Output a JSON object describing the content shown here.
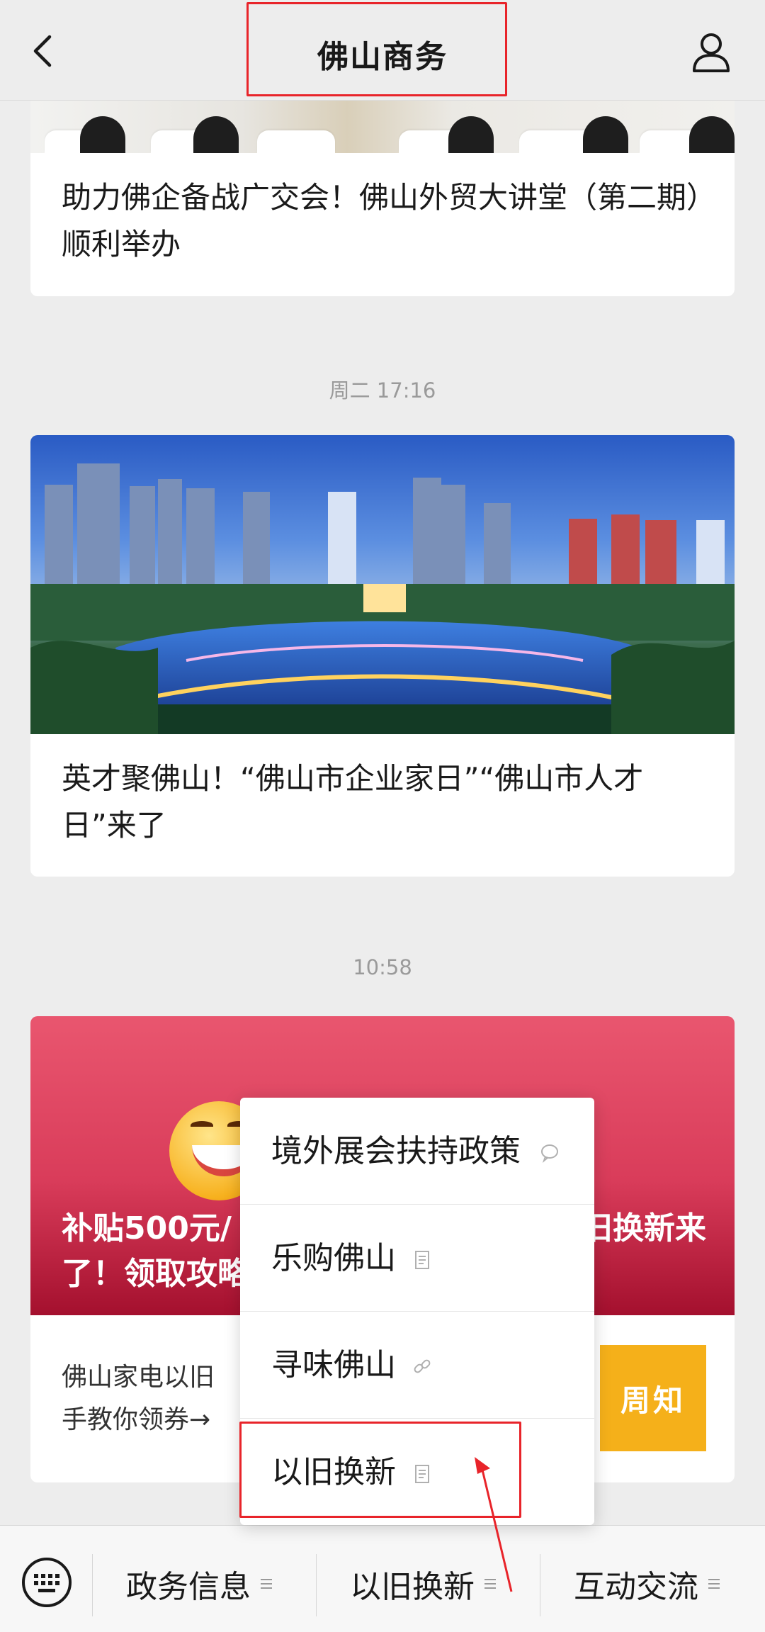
{
  "header": {
    "title": "佛山商务",
    "back_icon": "chevron-left-icon",
    "profile_icon": "person-icon"
  },
  "messages": [
    {
      "title": "助力佛企备战广交会！佛山外贸大讲堂（第二期）顺利举办"
    },
    {
      "timestamp": "周二 17:16",
      "title": "英才聚佛山！“佛山市企业家日”“佛山市人才日”来了"
    },
    {
      "timestamp": "10:58",
      "title": "补贴500元/",
      "title_right": "旧换新来",
      "title_line2": "了！领取攻略",
      "body_line1": "佛山家电以旧",
      "body_line2": "手教你领券→",
      "tag": "周知"
    }
  ],
  "popup_menu": {
    "items": [
      {
        "label": "境外展会扶持政策",
        "icon": "chat-bubble-icon"
      },
      {
        "label": "乐购佛山",
        "icon": "document-icon"
      },
      {
        "label": "寻味佛山",
        "icon": "link-icon"
      },
      {
        "label": "以旧换新",
        "icon": "document-icon"
      }
    ]
  },
  "bottom_menu": {
    "keyboard_icon": "keyboard-icon",
    "items": [
      {
        "label": "政务信息"
      },
      {
        "label": "以旧换新"
      },
      {
        "label": "互动交流"
      }
    ]
  },
  "colors": {
    "annotation_red": "#e8242a",
    "background": "#ededed",
    "promo_pink": "#d93c5a",
    "tag_yellow": "#f5b01a"
  }
}
